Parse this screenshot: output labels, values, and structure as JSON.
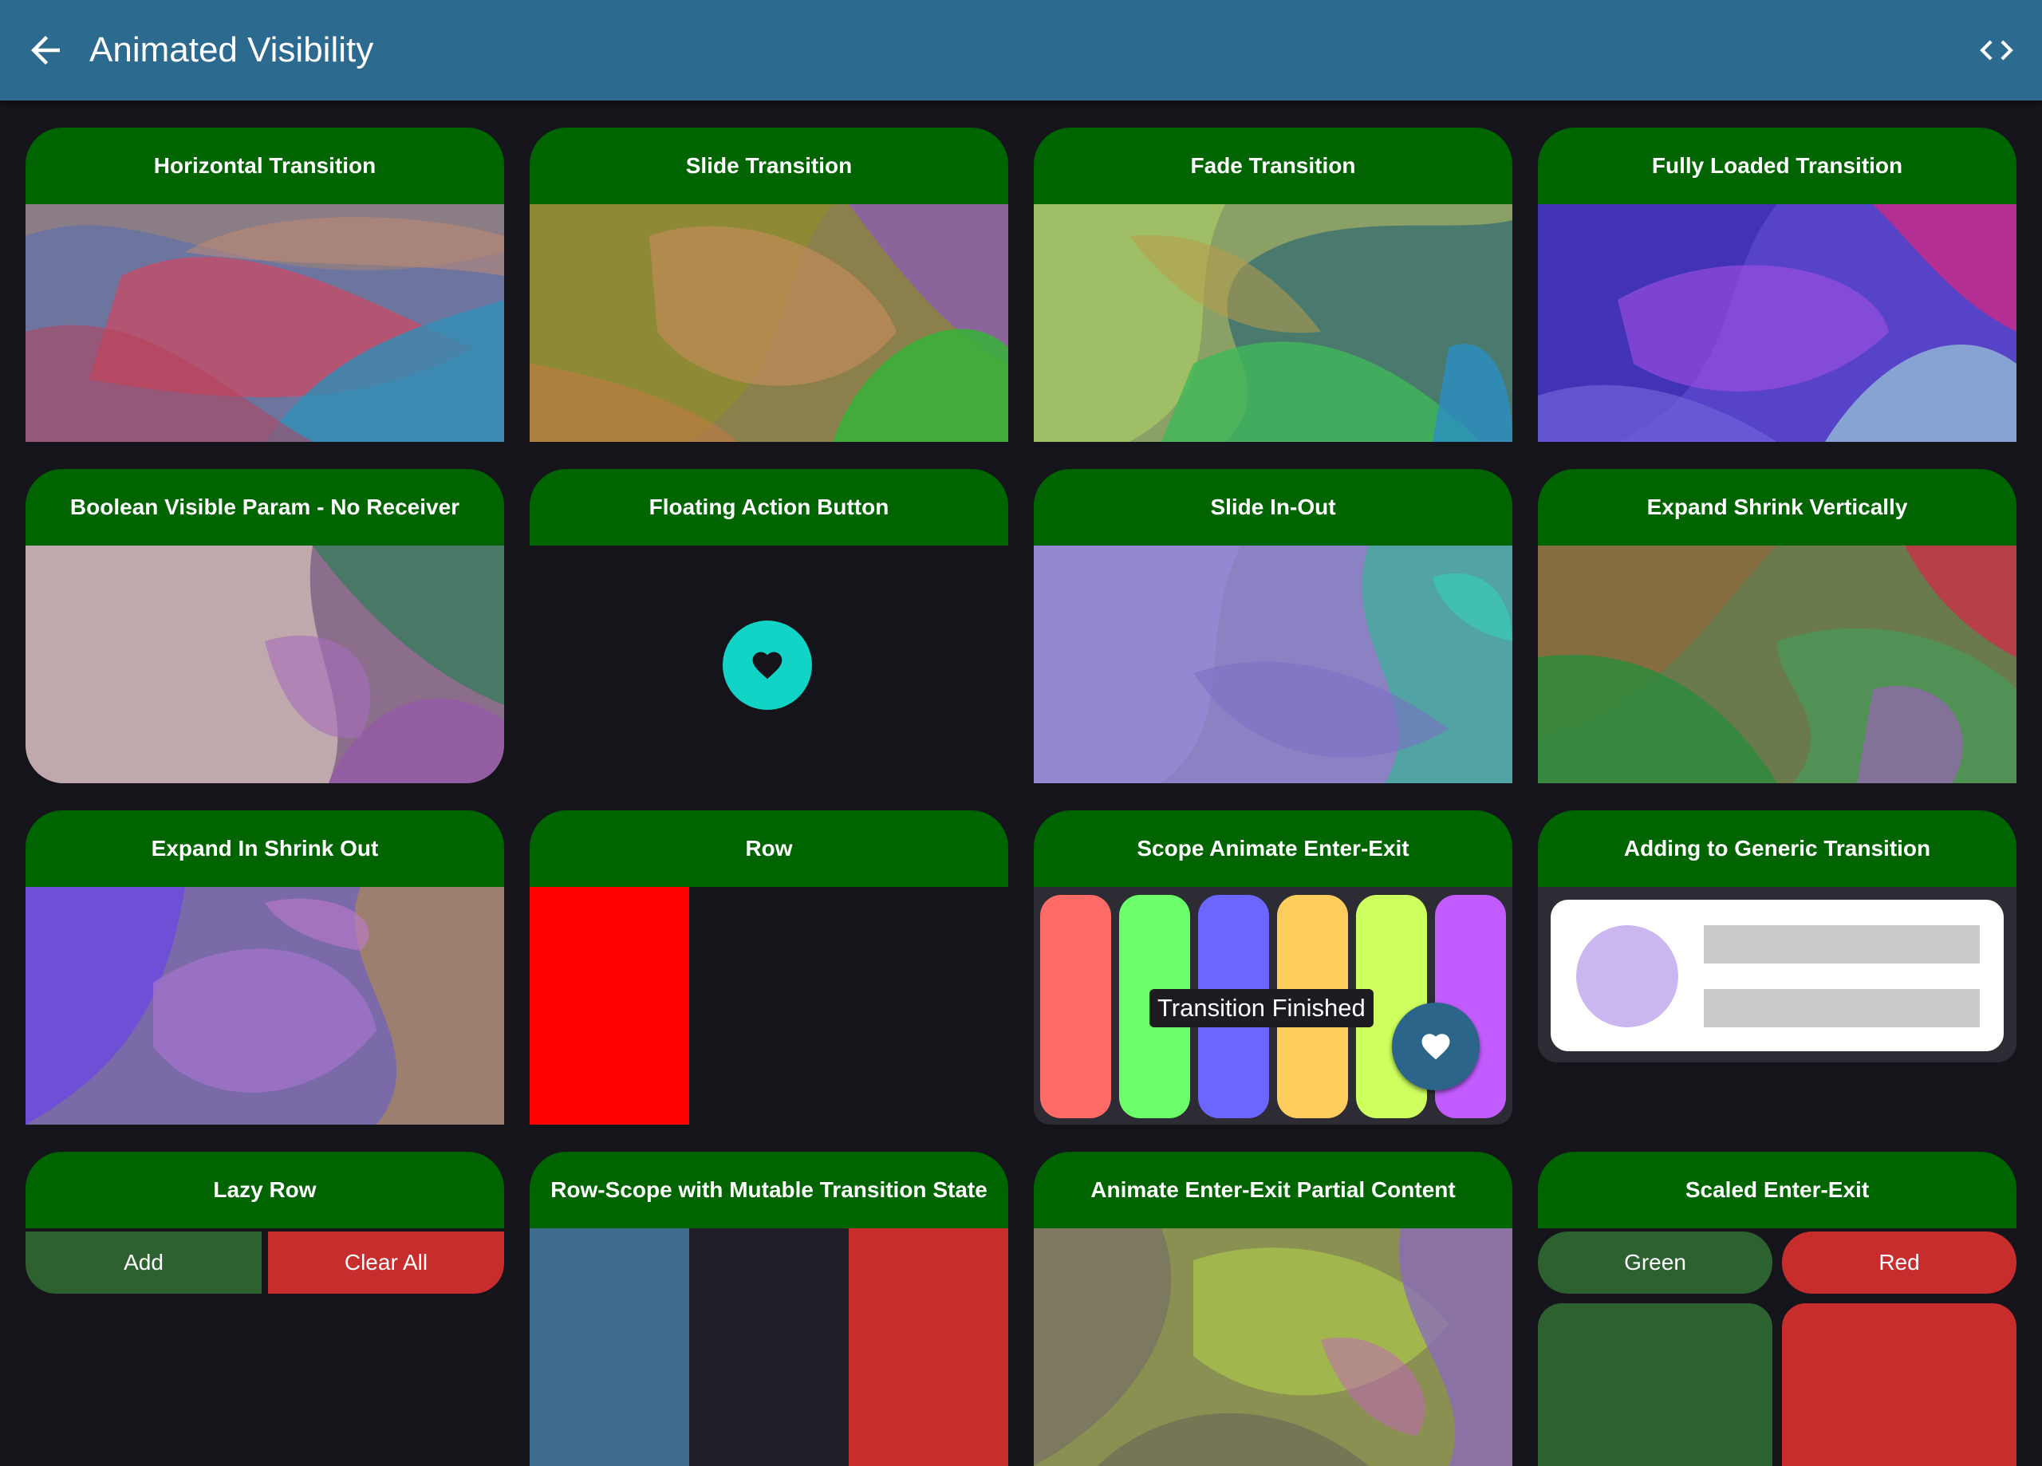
{
  "app_bar": {
    "title": "Animated Visibility",
    "back_icon": "arrow-back-icon",
    "code_icon": "code-icon"
  },
  "colors": {
    "app_bar": "#2c6a8f",
    "header": "#006400",
    "background": "#15141a",
    "fab": "#11d3c6",
    "red": "#ff0000",
    "pills": [
      "#ff6b66",
      "#6dff6b",
      "#6b66ff",
      "#ffcd5e",
      "#cdff5e",
      "#c25cff"
    ]
  },
  "cards": [
    {
      "title": "Horizontal Transition"
    },
    {
      "title": "Slide Transition"
    },
    {
      "title": "Fade Transition"
    },
    {
      "title": "Fully Loaded Transition"
    },
    {
      "title": "Boolean Visible Param - No Receiver"
    },
    {
      "title": "Floating Action Button"
    },
    {
      "title": "Slide In-Out"
    },
    {
      "title": "Expand Shrink Vertically"
    },
    {
      "title": "Expand In Shrink Out"
    },
    {
      "title": "Row"
    },
    {
      "title": "Scope Animate Enter-Exit"
    },
    {
      "title": "Adding to Generic Transition"
    },
    {
      "title": "Lazy Row"
    },
    {
      "title": "Row-Scope with Mutable Transition State"
    },
    {
      "title": "Animate Enter-Exit Partial Content"
    },
    {
      "title": "Scaled Enter-Exit"
    }
  ],
  "scope_animate": {
    "tooltip": "Transition Finished",
    "fab_icon": "heart-icon"
  },
  "floating_action_button": {
    "icon": "heart-icon"
  },
  "lazy_row": {
    "add_label": "Add",
    "clear_label": "Clear All"
  },
  "scaled": {
    "green_label": "Green",
    "red_label": "Red"
  }
}
